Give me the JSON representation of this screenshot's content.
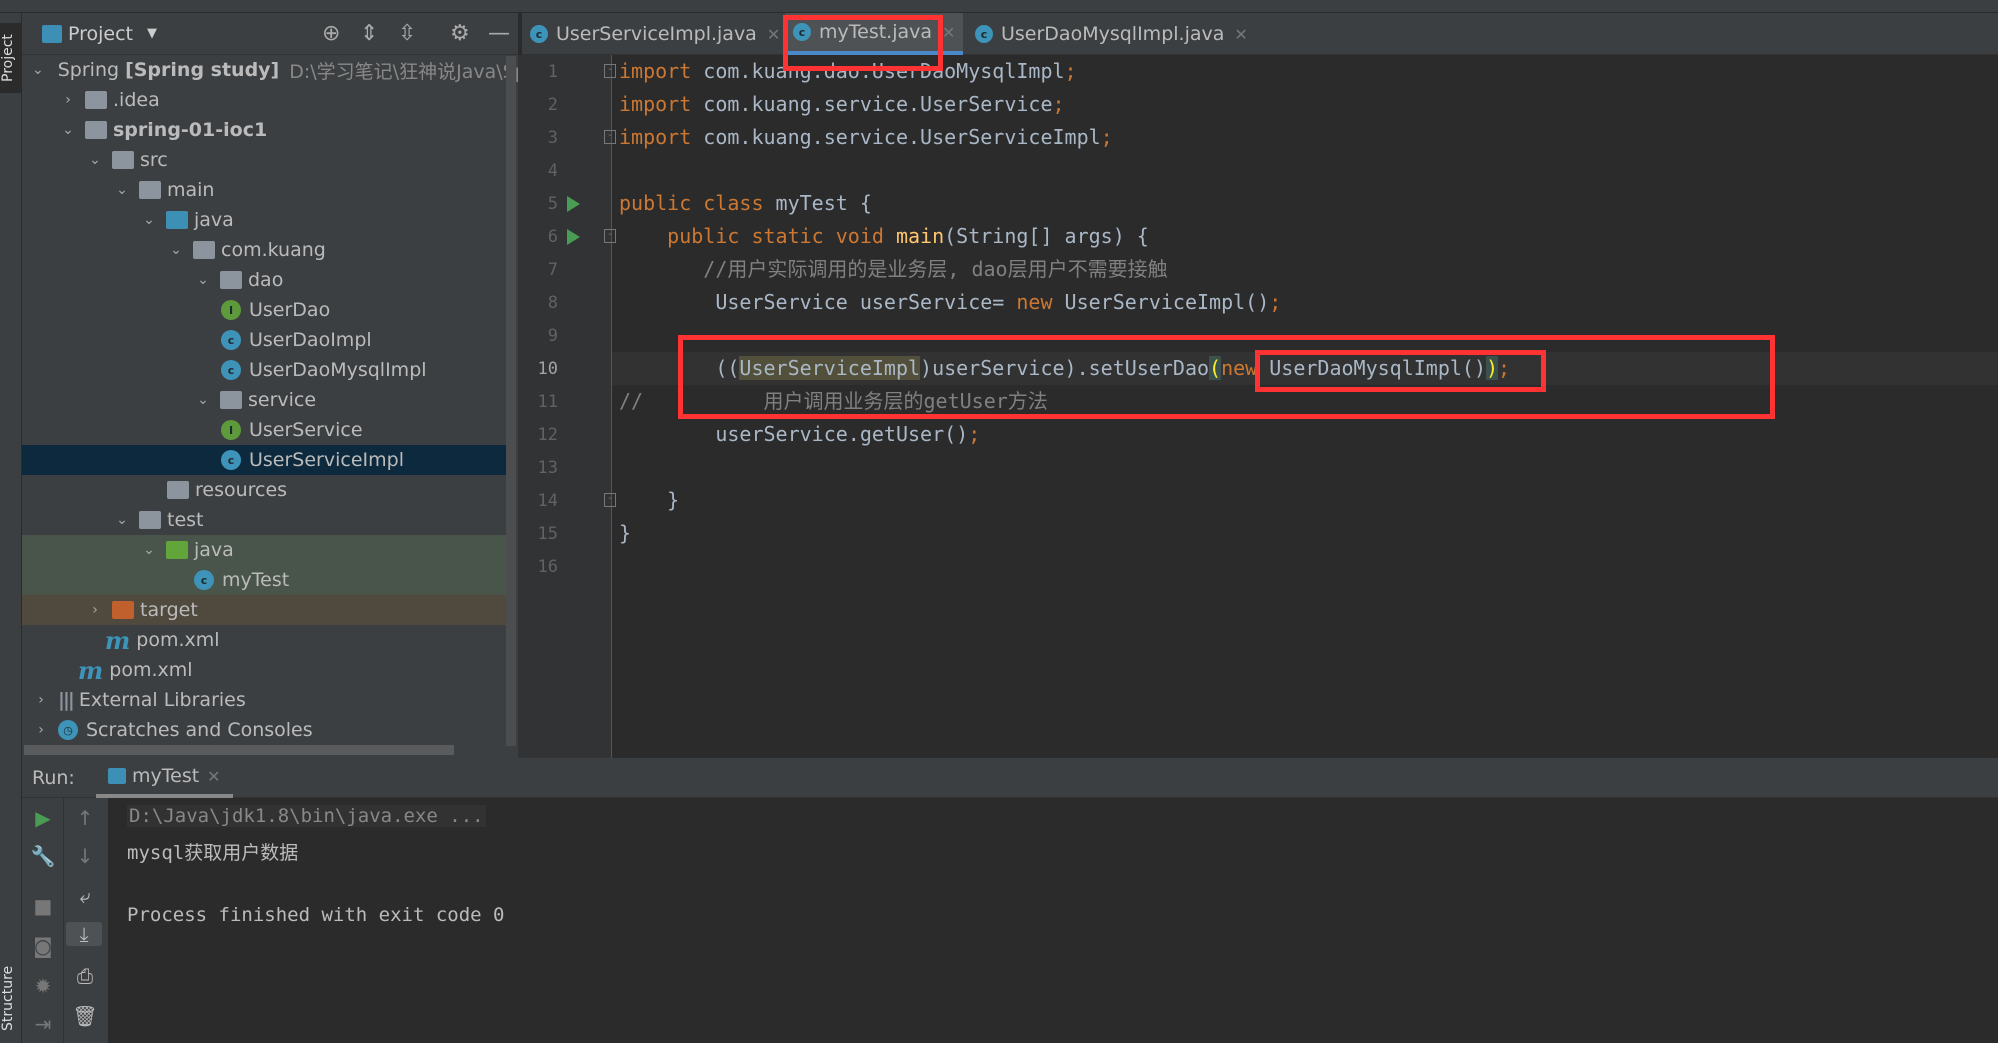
{
  "left_strip": {
    "project_label": "Project",
    "structure_label": "Structure"
  },
  "project_panel": {
    "title": "Project",
    "tree": [
      {
        "label": "Spring",
        "bold": "[Spring study]",
        "path": "D:\\学习笔记\\狂神说Java\\Spr",
        "depth": 0,
        "chevron": "down",
        "icon": "module"
      },
      {
        "label": ".idea",
        "depth": 1,
        "chevron": "right",
        "icon": "folder"
      },
      {
        "label": "spring-01-ioc1",
        "depth": 1,
        "chevron": "down",
        "icon": "module",
        "bold_label": true
      },
      {
        "label": "src",
        "depth": 2,
        "chevron": "down",
        "icon": "folder"
      },
      {
        "label": "main",
        "depth": 3,
        "chevron": "down",
        "icon": "folder"
      },
      {
        "label": "java",
        "depth": 4,
        "chevron": "down",
        "icon": "folder-blue"
      },
      {
        "label": "com.kuang",
        "depth": 5,
        "chevron": "down",
        "icon": "package"
      },
      {
        "label": "dao",
        "depth": 6,
        "chevron": "down",
        "icon": "package"
      },
      {
        "label": "UserDao",
        "depth": 7,
        "icon": "interface"
      },
      {
        "label": "UserDaoImpl",
        "depth": 7,
        "icon": "class"
      },
      {
        "label": "UserDaoMysqlImpl",
        "depth": 7,
        "icon": "class"
      },
      {
        "label": "service",
        "depth": 6,
        "chevron": "down",
        "icon": "package"
      },
      {
        "label": "UserService",
        "depth": 7,
        "icon": "interface"
      },
      {
        "label": "UserServiceImpl",
        "depth": 7,
        "icon": "class",
        "selected": true
      },
      {
        "label": "resources",
        "depth": 5,
        "icon": "folder"
      },
      {
        "label": "test",
        "depth": 3,
        "chevron": "down",
        "icon": "folder"
      },
      {
        "label": "java",
        "depth": 4,
        "chevron": "down",
        "icon": "folder-green",
        "test": true
      },
      {
        "label": "myTest",
        "depth": 6,
        "icon": "class-run",
        "test": true
      },
      {
        "label": "target",
        "depth": 2,
        "chevron": "right",
        "icon": "folder-orange",
        "excluded": true
      },
      {
        "label": "pom.xml",
        "depth": 2.7,
        "icon": "maven"
      },
      {
        "label": "pom.xml",
        "depth": 1.7,
        "icon": "maven"
      },
      {
        "label": "External Libraries",
        "depth": 0,
        "chevron": "right",
        "icon": "libraries"
      },
      {
        "label": "Scratches and Consoles",
        "depth": 0,
        "chevron": "right",
        "icon": "scratches"
      }
    ]
  },
  "editor": {
    "tabs": [
      {
        "label": "UserServiceImpl.java",
        "active": false
      },
      {
        "label": "myTest.java",
        "active": true
      },
      {
        "label": "UserDaoMysqlImpl.java",
        "active": false
      }
    ],
    "current_line": 10,
    "lines": [
      [
        [
          "import",
          "kw"
        ],
        [
          " com.kuang.dao.UserDaoMysqlImpl",
          ""
        ],
        [
          ";",
          "kw"
        ]
      ],
      [
        [
          "import",
          "kw"
        ],
        [
          " com.kuang.service.UserService",
          ""
        ],
        [
          ";",
          "kw"
        ]
      ],
      [
        [
          "import",
          "kw"
        ],
        [
          " com.kuang.service.UserServiceImpl",
          ""
        ],
        [
          ";",
          "kw"
        ]
      ],
      [],
      [
        [
          "public class ",
          "kw"
        ],
        [
          "myTest {",
          ""
        ]
      ],
      [
        [
          "    public static void ",
          "kw"
        ],
        [
          "main",
          "fn"
        ],
        [
          "(String[] args) {",
          ""
        ]
      ],
      [
        [
          "       //用户实际调用的是业务层, dao层用户不需要接触",
          "cm"
        ]
      ],
      [
        [
          "        UserService userService= ",
          ""
        ],
        [
          "new ",
          "kw"
        ],
        [
          "UserServiceImpl()",
          ""
        ],
        [
          ";",
          "kw"
        ]
      ],
      [],
      [
        [
          "        ((",
          ""
        ],
        [
          "UserServiceImpl",
          "hl"
        ],
        [
          ")userService).setUserDao",
          ""
        ],
        [
          "(",
          "br"
        ],
        [
          "new ",
          "kw"
        ],
        [
          "UserDaoMysqlImpl()",
          ""
        ],
        [
          ")",
          "br"
        ],
        [
          ";",
          "kw"
        ]
      ],
      [
        [
          "//          用户调用业务层的getUser方法",
          "cm"
        ]
      ],
      [
        [
          "        userService.getUser()",
          ""
        ],
        [
          ";",
          "kw"
        ]
      ],
      [],
      [
        [
          "    }",
          ""
        ]
      ],
      [
        [
          "}",
          ""
        ]
      ],
      []
    ]
  },
  "run": {
    "label": "Run:",
    "tab": "myTest",
    "output": [
      "D:\\Java\\jdk1.8\\bin\\java.exe ...",
      "mysql获取用户数据",
      "",
      "Process finished with exit code 0"
    ]
  },
  "colors": {
    "annotation": "#ff3333",
    "keyword": "#cc7832",
    "selection": "#0d293e"
  }
}
